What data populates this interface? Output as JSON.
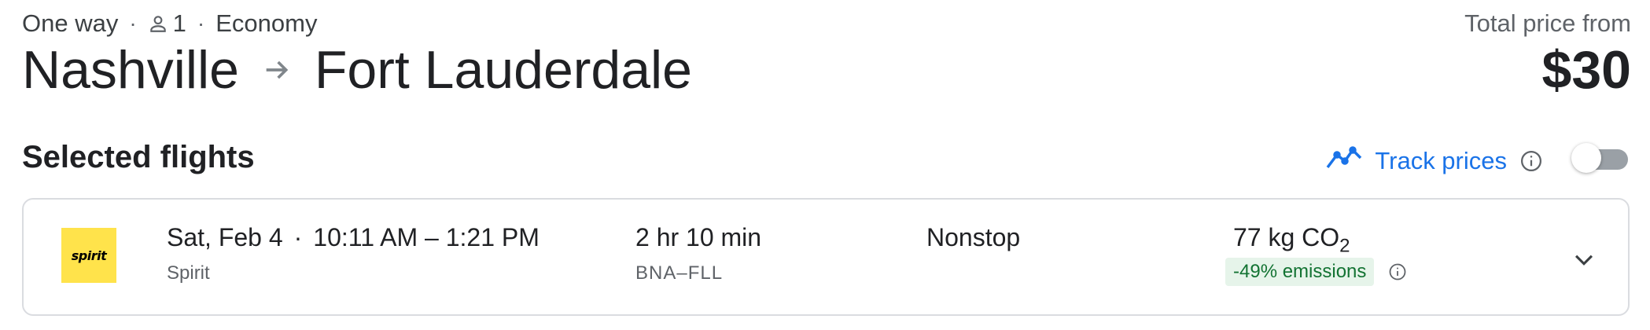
{
  "trip": {
    "type": "One way",
    "passengers": "1",
    "cabin": "Economy",
    "separator": "·"
  },
  "route": {
    "origin": "Nashville",
    "destination": "Fort Lauderdale"
  },
  "price": {
    "label": "Total price from",
    "value": "$30"
  },
  "section": {
    "title": "Selected flights"
  },
  "track": {
    "label": "Track prices",
    "enabled": false,
    "color": "#1a73e8"
  },
  "flight": {
    "logo_text": "spirit",
    "logo_color": "#ffe34b",
    "date": "Sat, Feb 4",
    "times": "10:11 AM – 1:21 PM",
    "airline": "Spirit",
    "duration": "2 hr 10 min",
    "airports": "BNA–FLL",
    "stops": "Nonstop",
    "co2_value": "77 kg CO",
    "co2_sub": "2",
    "emissions": "-49% emissions"
  },
  "icons": {
    "person": "person-icon",
    "arrow": "arrow-right-icon",
    "trend": "trend-icon",
    "info": "info-icon",
    "chevron": "chevron-down-icon"
  }
}
